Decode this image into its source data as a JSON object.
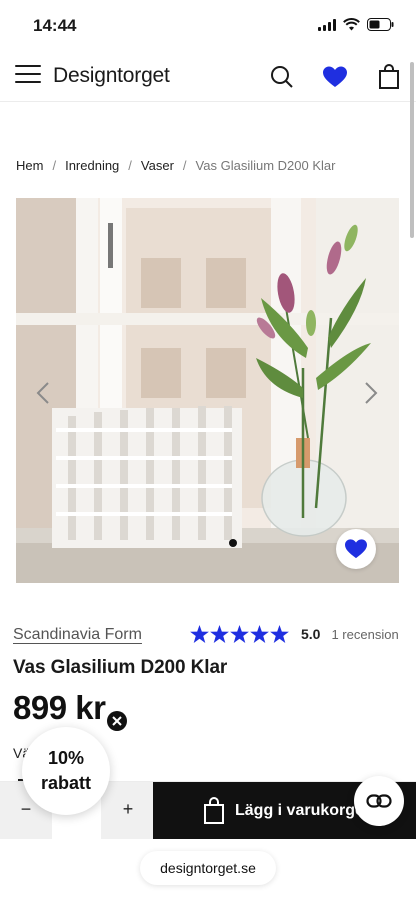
{
  "status_bar": {
    "time": "14:44"
  },
  "header": {
    "brand": "Designtorget"
  },
  "breadcrumb": {
    "items": [
      "Hem",
      "Inredning",
      "Vaser"
    ],
    "current": "Vas Glasilium D200 Klar",
    "separator": "/"
  },
  "product": {
    "brand": "Scandinavia Form",
    "rating_value": "5.0",
    "review_count": "1 recension",
    "stars": 5,
    "title": "Vas Glasilium D200 Klar",
    "price": "899 kr",
    "partial_text": "Vä"
  },
  "carousel": {
    "current_slide": 1,
    "total_slides": 1
  },
  "cart": {
    "minus": "−",
    "plus": "+",
    "add_label": "Lägg i varukorgen"
  },
  "discount": {
    "percent": "10%",
    "label": "rabatt"
  },
  "browser": {
    "url": "designtorget.se"
  },
  "colors": {
    "accent_blue": "#1f2fe0",
    "cart_button": "#111111",
    "qty_bg": "#f0f0f0"
  },
  "icons": [
    "menu-icon",
    "search-icon",
    "heart-icon",
    "bag-icon",
    "chevron-left-icon",
    "chevron-right-icon",
    "star-icon",
    "close-icon",
    "chat-icon"
  ]
}
